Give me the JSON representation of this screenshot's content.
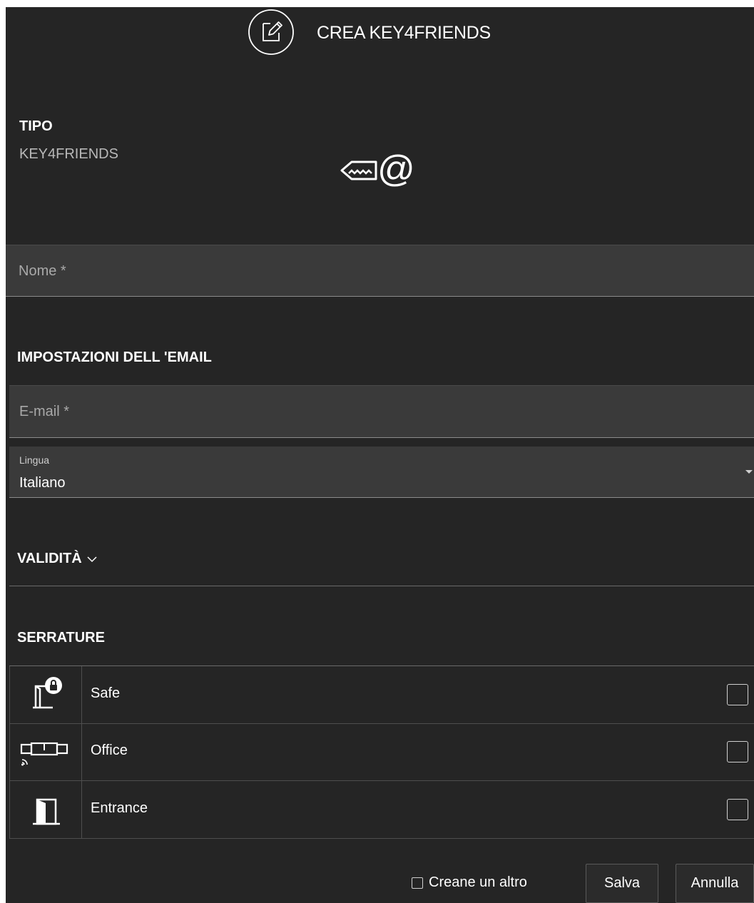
{
  "header": {
    "title": "CREA KEY4FRIENDS",
    "icon": "edit-icon"
  },
  "tipo": {
    "label": "TIPO",
    "value": "KEY4FRIENDS",
    "icon": "key-at-icon"
  },
  "nome_field": {
    "placeholder": "Nome *"
  },
  "email_settings": {
    "title": "IMPOSTAZIONI DELL 'EMAIL",
    "email_placeholder": "E-mail *",
    "language_label": "Lingua",
    "language_value": "Italiano"
  },
  "validity": {
    "label": "VALIDITÀ",
    "icon": "chevron-down-icon"
  },
  "locks": {
    "title": "SERRATURE",
    "items": [
      {
        "name": "Safe",
        "icon": "safe-lock-icon",
        "checked": false
      },
      {
        "name": "Office",
        "icon": "office-lock-icon",
        "checked": false
      },
      {
        "name": "Entrance",
        "icon": "entrance-door-icon",
        "checked": false
      }
    ]
  },
  "footer": {
    "create_another_label": "Creane un altro",
    "create_another_checked": false,
    "save_label": "Salva",
    "cancel_label": "Annulla"
  },
  "colors": {
    "background": "#252525",
    "field": "#3a3a3a",
    "text": "#ffffff",
    "muted": "#b4b4b4"
  }
}
